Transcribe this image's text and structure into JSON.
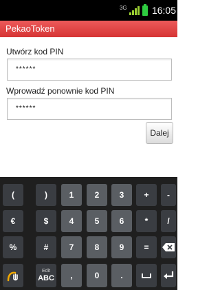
{
  "status_bar": {
    "network": "3G",
    "time": "16:05"
  },
  "app_bar": {
    "title": "PekaoToken"
  },
  "form": {
    "create_pin_label": "Utwórz kod PIN",
    "create_pin_value": "******",
    "confirm_pin_label": "Wprowadź ponownie kod PIN",
    "confirm_pin_value": "******",
    "next_button": "Dalej"
  },
  "keyboard": {
    "rows": [
      [
        "(",
        ")",
        "1",
        "2",
        "3",
        "+",
        "-"
      ],
      [
        "€",
        "$",
        "4",
        "5",
        "6",
        "*",
        "/"
      ],
      [
        "%",
        "#",
        "7",
        "8",
        "9",
        "=",
        "backspace-icon"
      ],
      [
        "hand-icon",
        "Edit ABC",
        ",",
        "0",
        ".",
        "space-icon",
        "enter-icon"
      ]
    ],
    "edit_key": {
      "sub": "Edit",
      "main": "ABC"
    }
  },
  "colors": {
    "app_bar": "#d63434",
    "key_symbol": "#3a3d42",
    "key_number": "#5a5e63",
    "keyboard_bg": "#1f1f1f"
  }
}
